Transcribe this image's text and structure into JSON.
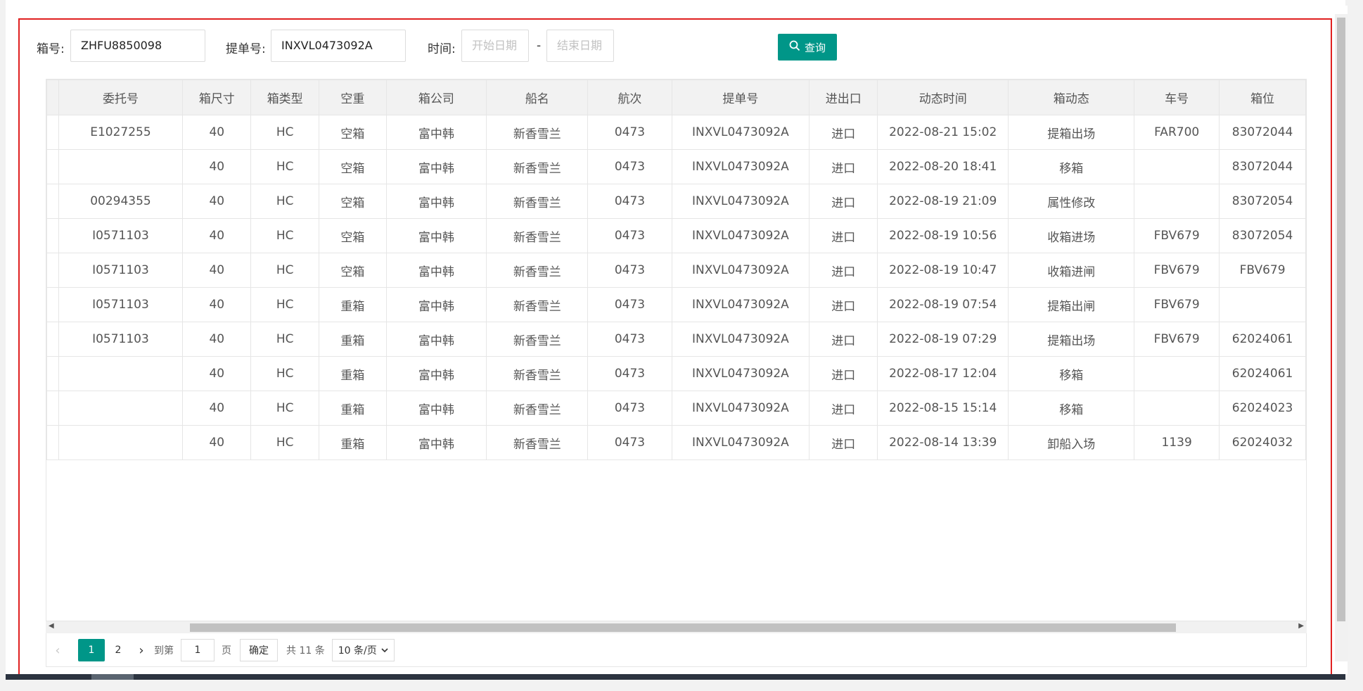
{
  "search": {
    "box_label": "箱号:",
    "box_value": "ZHFU8850098",
    "bill_label": "提单号:",
    "bill_value": "INXVL0473092A",
    "time_label": "时间:",
    "start_placeholder": "开始日期",
    "date_sep": "-",
    "end_placeholder": "结束日期",
    "query_label": "查询"
  },
  "table": {
    "headers": [
      "委托号",
      "箱尺寸",
      "箱类型",
      "空重",
      "箱公司",
      "船名",
      "航次",
      "提单号",
      "进出口",
      "动态时间",
      "箱动态",
      "车号",
      "箱位"
    ],
    "rows": [
      [
        "E1027255",
        "40",
        "HC",
        "空箱",
        "富中韩",
        "新香雪兰",
        "0473",
        "INXVL0473092A",
        "进口",
        "2022-08-21 15:02",
        "提箱出场",
        "FAR700",
        "83072044"
      ],
      [
        "",
        "40",
        "HC",
        "空箱",
        "富中韩",
        "新香雪兰",
        "0473",
        "INXVL0473092A",
        "进口",
        "2022-08-20 18:41",
        "移箱",
        "",
        "83072044"
      ],
      [
        "00294355",
        "40",
        "HC",
        "空箱",
        "富中韩",
        "新香雪兰",
        "0473",
        "INXVL0473092A",
        "进口",
        "2022-08-19 21:09",
        "属性修改",
        "",
        "83072054"
      ],
      [
        "I0571103",
        "40",
        "HC",
        "空箱",
        "富中韩",
        "新香雪兰",
        "0473",
        "INXVL0473092A",
        "进口",
        "2022-08-19 10:56",
        "收箱进场",
        "FBV679",
        "83072054"
      ],
      [
        "I0571103",
        "40",
        "HC",
        "空箱",
        "富中韩",
        "新香雪兰",
        "0473",
        "INXVL0473092A",
        "进口",
        "2022-08-19 10:47",
        "收箱进闸",
        "FBV679",
        "FBV679"
      ],
      [
        "I0571103",
        "40",
        "HC",
        "重箱",
        "富中韩",
        "新香雪兰",
        "0473",
        "INXVL0473092A",
        "进口",
        "2022-08-19 07:54",
        "提箱出闸",
        "FBV679",
        ""
      ],
      [
        "I0571103",
        "40",
        "HC",
        "重箱",
        "富中韩",
        "新香雪兰",
        "0473",
        "INXVL0473092A",
        "进口",
        "2022-08-19 07:29",
        "提箱出场",
        "FBV679",
        "62024061"
      ],
      [
        "",
        "40",
        "HC",
        "重箱",
        "富中韩",
        "新香雪兰",
        "0473",
        "INXVL0473092A",
        "进口",
        "2022-08-17 12:04",
        "移箱",
        "",
        "62024061"
      ],
      [
        "",
        "40",
        "HC",
        "重箱",
        "富中韩",
        "新香雪兰",
        "0473",
        "INXVL0473092A",
        "进口",
        "2022-08-15 15:14",
        "移箱",
        "",
        "62024023"
      ],
      [
        "",
        "40",
        "HC",
        "重箱",
        "富中韩",
        "新香雪兰",
        "0473",
        "INXVL0473092A",
        "进口",
        "2022-08-14 13:39",
        "卸船入场",
        "1139",
        "62024032"
      ]
    ]
  },
  "pager": {
    "current": "1",
    "page2": "2",
    "goto_label": "到第",
    "goto_value": "1",
    "page_unit": "页",
    "confirm_label": "确定",
    "total_label": "共 11 条",
    "size_label": "10 条/页"
  }
}
